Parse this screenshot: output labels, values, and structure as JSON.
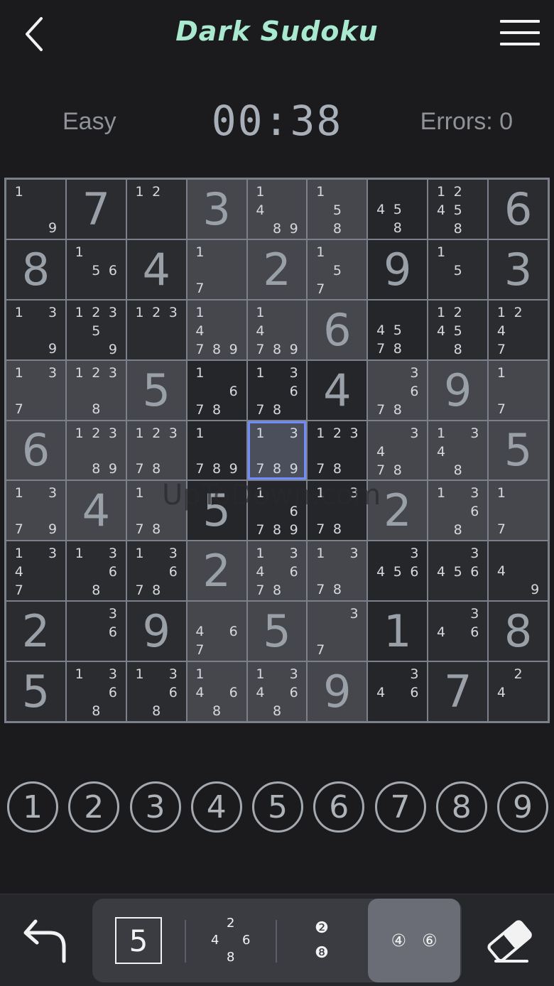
{
  "header": {
    "title": "Dark Sudoku"
  },
  "status": {
    "difficulty": "Easy",
    "timer": "00:38",
    "errors": "Errors: 0"
  },
  "board": [
    [
      {
        "n": [
          1,
          9
        ]
      },
      {
        "v": 7
      },
      {
        "n": [
          1,
          2
        ]
      },
      {
        "v": 3,
        "s": "light"
      },
      {
        "n": [
          1,
          4,
          8,
          9
        ],
        "s": "light"
      },
      {
        "n": [
          1,
          5,
          8
        ],
        "s": "light"
      },
      {
        "n": [
          4,
          5,
          8
        ],
        "s": "dark"
      },
      {
        "n": [
          1,
          2,
          4,
          5,
          8
        ]
      },
      {
        "v": 6
      }
    ],
    [
      {
        "v": 8
      },
      {
        "n": [
          1,
          5,
          6
        ]
      },
      {
        "v": 4
      },
      {
        "n": [
          1,
          7
        ],
        "s": "light"
      },
      {
        "v": 2,
        "s": "light"
      },
      {
        "n": [
          1,
          5,
          7
        ],
        "s": "light"
      },
      {
        "v": 9,
        "s": "dark"
      },
      {
        "n": [
          1,
          5
        ]
      },
      {
        "v": 3
      }
    ],
    [
      {
        "n": [
          1,
          3,
          9
        ]
      },
      {
        "n": [
          1,
          2,
          3,
          5,
          9
        ]
      },
      {
        "n": [
          1,
          2,
          3
        ]
      },
      {
        "n": [
          1,
          4,
          7,
          8,
          9
        ],
        "s": "light"
      },
      {
        "n": [
          1,
          4,
          7,
          8,
          9
        ],
        "s": "light"
      },
      {
        "v": 6,
        "s": "light"
      },
      {
        "n": [
          4,
          5,
          7,
          8
        ],
        "s": "dark"
      },
      {
        "n": [
          1,
          2,
          4,
          5,
          8
        ]
      },
      {
        "n": [
          1,
          2,
          4,
          7
        ]
      }
    ],
    [
      {
        "n": [
          1,
          3,
          7
        ],
        "s": "light"
      },
      {
        "n": [
          1,
          2,
          3,
          8
        ],
        "s": "light"
      },
      {
        "v": 5,
        "s": "light"
      },
      {
        "n": [
          1,
          6,
          7,
          8
        ],
        "s": "dark"
      },
      {
        "n": [
          1,
          3,
          6,
          7,
          8
        ],
        "s": "dark"
      },
      {
        "v": 4,
        "s": "dark"
      },
      {
        "n": [
          3,
          6,
          7,
          8
        ],
        "s": "light"
      },
      {
        "v": 9,
        "s": "light"
      },
      {
        "n": [
          1,
          7
        ],
        "s": "light"
      }
    ],
    [
      {
        "v": 6,
        "s": "light"
      },
      {
        "n": [
          1,
          2,
          3,
          8,
          9
        ],
        "s": "light"
      },
      {
        "n": [
          1,
          2,
          3,
          7,
          8
        ],
        "s": "light"
      },
      {
        "n": [
          1,
          7,
          8,
          9
        ],
        "s": "dark"
      },
      {
        "n": [
          1,
          3,
          7,
          8,
          9
        ],
        "s": "selected"
      },
      {
        "n": [
          1,
          2,
          3,
          7,
          8
        ],
        "s": "dark"
      },
      {
        "n": [
          3,
          4,
          7,
          8
        ],
        "s": "light"
      },
      {
        "n": [
          1,
          3,
          4,
          8
        ],
        "s": "light"
      },
      {
        "v": 5,
        "s": "light"
      }
    ],
    [
      {
        "n": [
          1,
          3,
          7,
          9
        ],
        "s": "light"
      },
      {
        "v": 4,
        "s": "light"
      },
      {
        "n": [
          1,
          7,
          8
        ],
        "s": "light"
      },
      {
        "v": 5,
        "s": "dark"
      },
      {
        "n": [
          1,
          6,
          7,
          8,
          9
        ],
        "s": "dark"
      },
      {
        "n": [
          1,
          3,
          7,
          8
        ],
        "s": "dark"
      },
      {
        "v": 2,
        "s": "light"
      },
      {
        "n": [
          1,
          3,
          6,
          8
        ],
        "s": "light"
      },
      {
        "n": [
          1,
          7
        ],
        "s": "light"
      }
    ],
    [
      {
        "n": [
          1,
          3,
          4,
          7
        ]
      },
      {
        "n": [
          1,
          3,
          6,
          8
        ]
      },
      {
        "n": [
          1,
          3,
          6,
          7,
          8
        ]
      },
      {
        "v": 2,
        "s": "light"
      },
      {
        "n": [
          1,
          3,
          4,
          6,
          7,
          8
        ],
        "s": "light"
      },
      {
        "n": [
          1,
          3,
          7,
          8
        ],
        "s": "light"
      },
      {
        "n": [
          3,
          4,
          5,
          6
        ],
        "s": "dark"
      },
      {
        "n": [
          3,
          4,
          5,
          6
        ]
      },
      {
        "n": [
          4,
          9
        ]
      }
    ],
    [
      {
        "v": 2
      },
      {
        "n": [
          3,
          6
        ]
      },
      {
        "v": 9
      },
      {
        "n": [
          4,
          6,
          7
        ],
        "s": "light"
      },
      {
        "v": 5,
        "s": "light"
      },
      {
        "n": [
          3,
          7
        ],
        "s": "light"
      },
      {
        "v": 1,
        "s": "dark"
      },
      {
        "n": [
          3,
          4,
          6
        ]
      },
      {
        "v": 8
      }
    ],
    [
      {
        "v": 5
      },
      {
        "n": [
          1,
          3,
          6,
          8
        ]
      },
      {
        "n": [
          1,
          3,
          6,
          8
        ]
      },
      {
        "n": [
          1,
          4,
          6,
          8
        ],
        "s": "light"
      },
      {
        "n": [
          1,
          3,
          4,
          6,
          8
        ],
        "s": "light"
      },
      {
        "v": 9,
        "s": "light"
      },
      {
        "n": [
          3,
          4,
          6
        ],
        "s": "dark"
      },
      {
        "v": 7
      },
      {
        "n": [
          2,
          4
        ]
      }
    ]
  ],
  "numpad": [
    "1",
    "2",
    "3",
    "4",
    "5",
    "6",
    "7",
    "8",
    "9"
  ],
  "toolbar": {
    "normal_mode": "5",
    "corner_mode": {
      "top": "2",
      "left": "4",
      "right": "6",
      "bottom": "8"
    },
    "center_mode": {
      "top": "❷",
      "bottom": "❽"
    },
    "color_mode": {
      "left": "④",
      "right": "⑥"
    }
  },
  "watermark": "UpToDown.com"
}
